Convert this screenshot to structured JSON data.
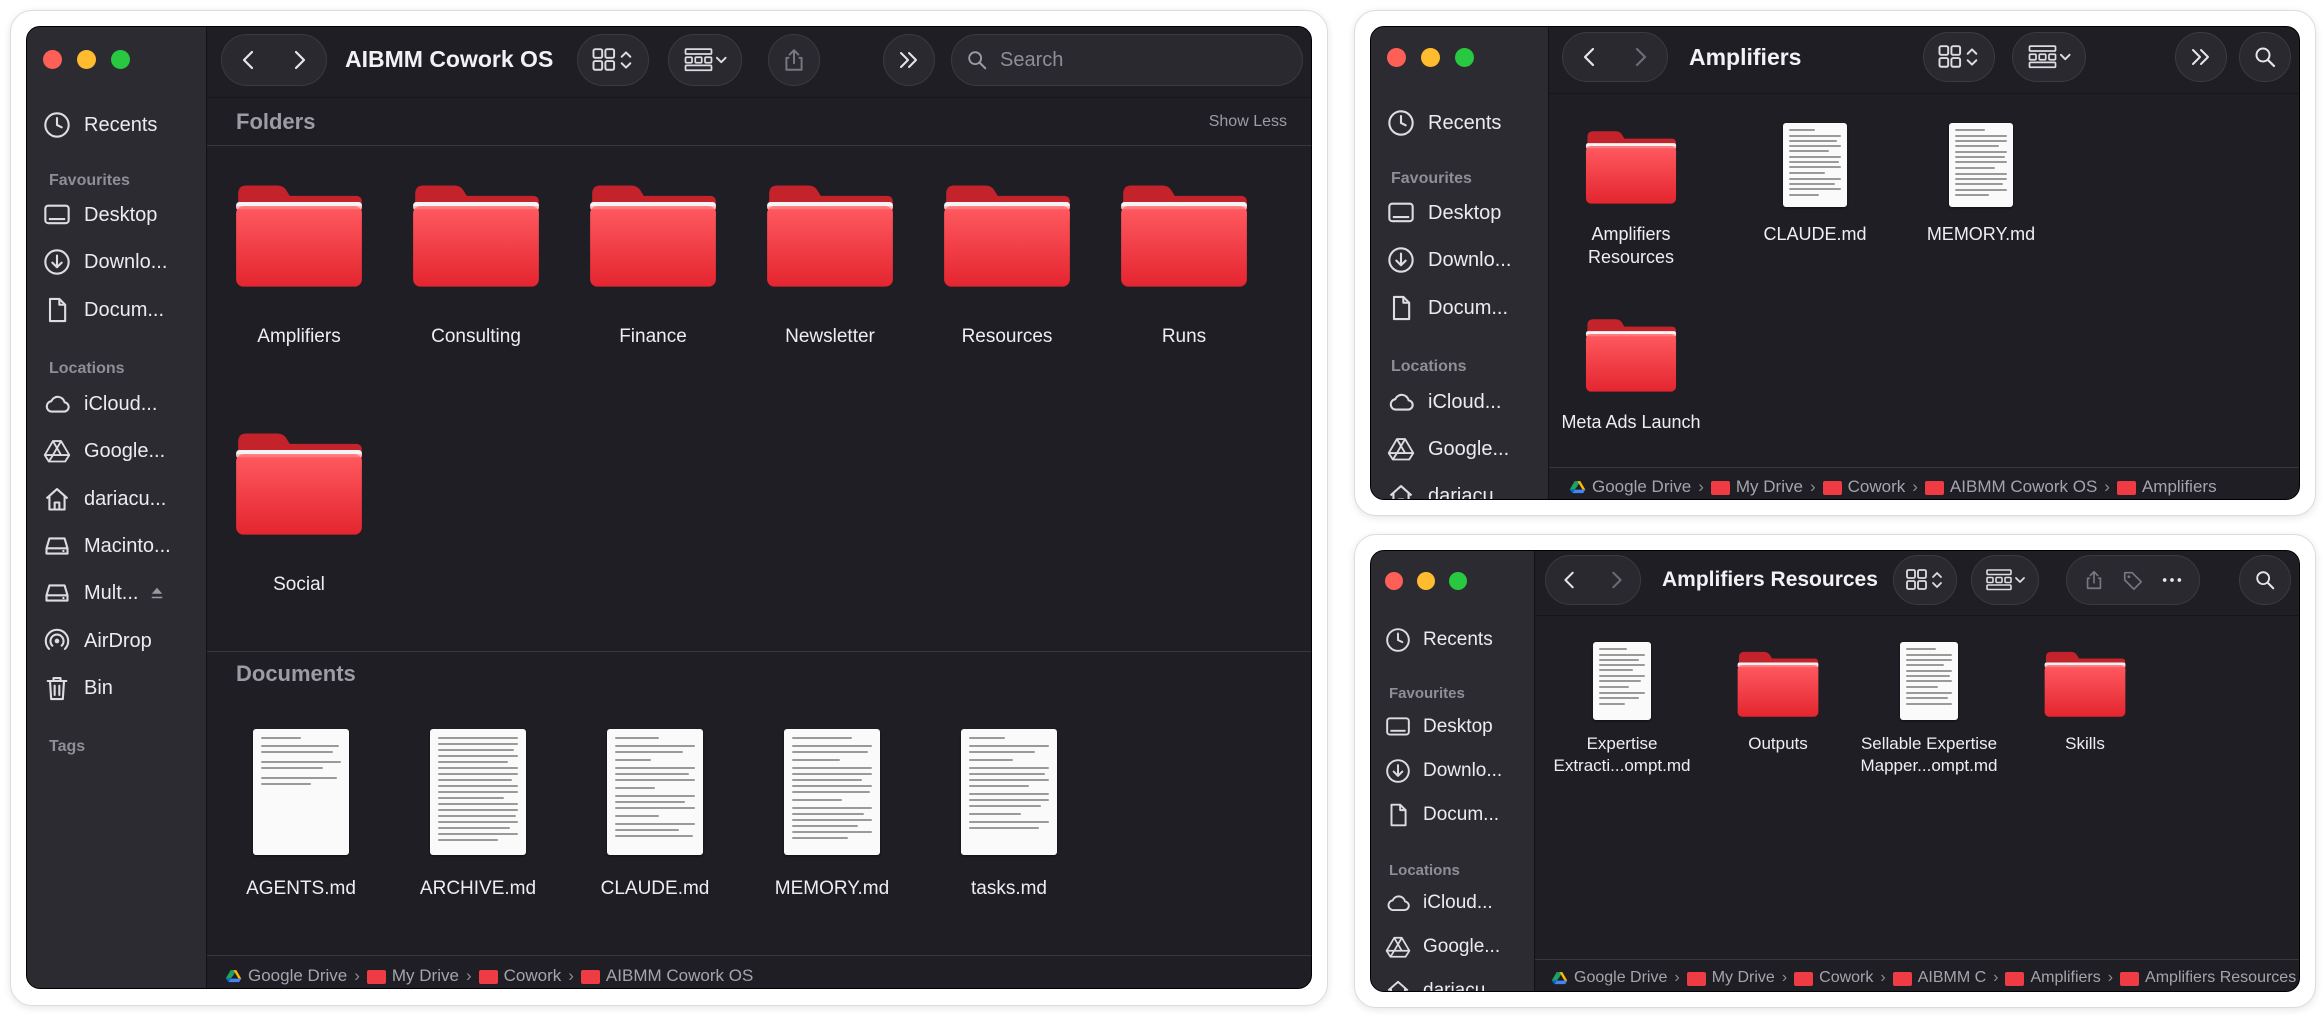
{
  "main": {
    "title": "AIBMM Cowork OS",
    "search_placeholder": "Search",
    "folders_heading": "Folders",
    "show_less": "Show Less",
    "folders": [
      "Amplifiers",
      "Consulting",
      "Finance",
      "Newsletter",
      "Resources",
      "Runs",
      "Social"
    ],
    "documents_heading": "Documents",
    "documents": [
      "AGENTS.md",
      "ARCHIVE.md",
      "CLAUDE.md",
      "MEMORY.md",
      "tasks.md"
    ],
    "path": [
      "Google Drive",
      "My Drive",
      "Cowork",
      "AIBMM Cowork OS"
    ]
  },
  "sidebar": {
    "recents": "Recents",
    "favourites_heading": "Favourites",
    "desktop": "Desktop",
    "downloads": "Downlo...",
    "documents": "Docum...",
    "locations_heading": "Locations",
    "icloud": "iCloud...",
    "google": "Google...",
    "home": "dariacu...",
    "macintosh": "Macinto...",
    "multi": "Mult...",
    "airdrop": "AirDrop",
    "bin": "Bin",
    "tags_heading": "Tags"
  },
  "amplifiers": {
    "title": "Amplifiers",
    "sidebar": {
      "recents": "Recents",
      "favourites_heading": "Favourites",
      "desktop": "Desktop",
      "downloads": "Downlo...",
      "documents": "Docum...",
      "locations_heading": "Locations",
      "icloud": "iCloud...",
      "google": "Google...",
      "home": "dariacu..."
    },
    "items": [
      {
        "name": "Amplifiers Resources",
        "kind": "folder"
      },
      {
        "name": "CLAUDE.md",
        "kind": "document"
      },
      {
        "name": "MEMORY.md",
        "kind": "document"
      },
      {
        "name": "Meta Ads Launch",
        "kind": "folder"
      }
    ],
    "path": [
      "Google Drive",
      "My Drive",
      "Cowork",
      "AIBMM Cowork OS",
      "Amplifiers"
    ]
  },
  "resources": {
    "title": "Amplifiers Resources",
    "sidebar": {
      "recents": "Recents",
      "favourites_heading": "Favourites",
      "desktop": "Desktop",
      "downloads": "Downlo...",
      "documents": "Docum...",
      "locations_heading": "Locations",
      "icloud": "iCloud...",
      "google": "Google...",
      "home": "dariacu..."
    },
    "items": [
      {
        "name": "Expertise Extracti...ompt.md",
        "kind": "document"
      },
      {
        "name": "Outputs",
        "kind": "folder"
      },
      {
        "name": "Sellable Expertise Mapper...ompt.md",
        "kind": "document"
      },
      {
        "name": "Skills",
        "kind": "folder"
      }
    ],
    "path": [
      "Google Drive",
      "My Drive",
      "Cowork",
      "AIBMM C",
      "Amplifiers",
      "Amplifiers Resources"
    ]
  },
  "colors": {
    "window_bg": "#1f1e24",
    "sidebar_bg": "#2c2b31",
    "folder_red": "#ef3c44",
    "close": "#fe5f57",
    "minimize": "#febc2e",
    "zoom": "#28c840"
  }
}
